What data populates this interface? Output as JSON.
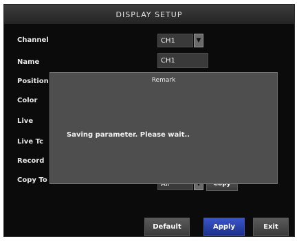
{
  "window": {
    "title": "DISPLAY SETUP"
  },
  "fields": {
    "channel": {
      "label": "Channel",
      "value": "CH1"
    },
    "name": {
      "label": "Name",
      "value": "CH1"
    },
    "position": {
      "label": "Position"
    },
    "color": {
      "label": "Color"
    },
    "live": {
      "label": "Live"
    },
    "live_time": {
      "label": "Live Tc"
    },
    "record": {
      "label": "Record"
    },
    "copy_to": {
      "label": "Copy To",
      "value": "All",
      "button": "Copy"
    }
  },
  "buttons": {
    "default": "Default",
    "apply": "Apply",
    "exit": "Exit"
  },
  "dialog": {
    "title": "Remark",
    "message": "Saving parameter. Please wait.."
  },
  "colors": {
    "background": "#0b0b0b",
    "dialog": "#4e4e4e",
    "apply_button": "#2a44b4"
  }
}
